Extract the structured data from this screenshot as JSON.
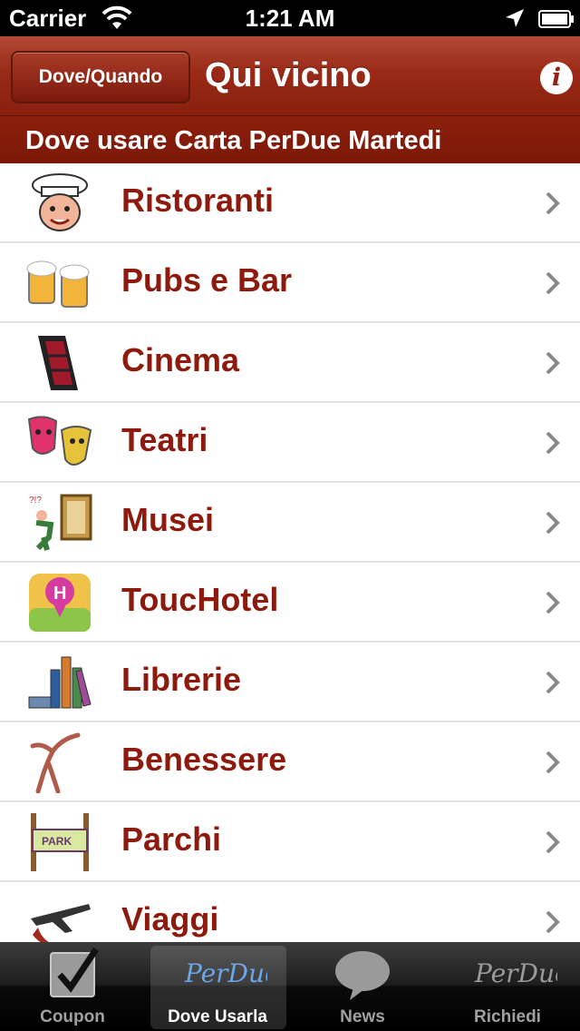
{
  "status_bar": {
    "carrier": "Carrier",
    "time": "1:21 AM"
  },
  "nav": {
    "left_button": "Dove/Quando",
    "title": "Qui vicino",
    "info": "i"
  },
  "section_header": "Dove usare Carta PerDue Martedi",
  "list": [
    {
      "label": "Ristoranti",
      "icon": "chef-icon"
    },
    {
      "label": "Pubs e Bar",
      "icon": "beer-mugs-icon"
    },
    {
      "label": "Cinema",
      "icon": "film-reel-icon"
    },
    {
      "label": "Teatri",
      "icon": "theater-masks-icon"
    },
    {
      "label": "Musei",
      "icon": "museum-painting-icon"
    },
    {
      "label": "ToucHotel",
      "icon": "hotel-pin-icon"
    },
    {
      "label": "Librerie",
      "icon": "books-icon"
    },
    {
      "label": "Benessere",
      "icon": "wellness-figure-icon"
    },
    {
      "label": "Parchi",
      "icon": "park-sign-icon"
    },
    {
      "label": "Viaggi",
      "icon": "airplane-icon"
    }
  ],
  "tabs": [
    {
      "label": "Coupon",
      "icon_text": ""
    },
    {
      "label": "Dove Usarla",
      "icon_text": "PerDue"
    },
    {
      "label": "News",
      "icon_text": ""
    },
    {
      "label": "Richiedi",
      "icon_text": "PerDue"
    }
  ],
  "colors": {
    "nav_red": "#9a2a17",
    "label_red": "#8d1a0c",
    "tab_bar": "#1d1d1d"
  }
}
